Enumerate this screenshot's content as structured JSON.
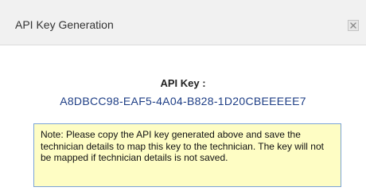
{
  "dialog": {
    "title": "API Key Generation",
    "close_icon": "close-icon"
  },
  "api_key": {
    "label": "API Key :",
    "value": "A8DBCC98-EAF5-4A04-B828-1D20CBEEEEE7",
    "value_color": "#1f3f86"
  },
  "note": {
    "text": "Note: Please copy the API key generated above and save the technician details to map this key to the technician. The key will not be mapped if technician details is not saved.",
    "background_color": "#fefdc4",
    "border_color": "#7aa3d6"
  }
}
